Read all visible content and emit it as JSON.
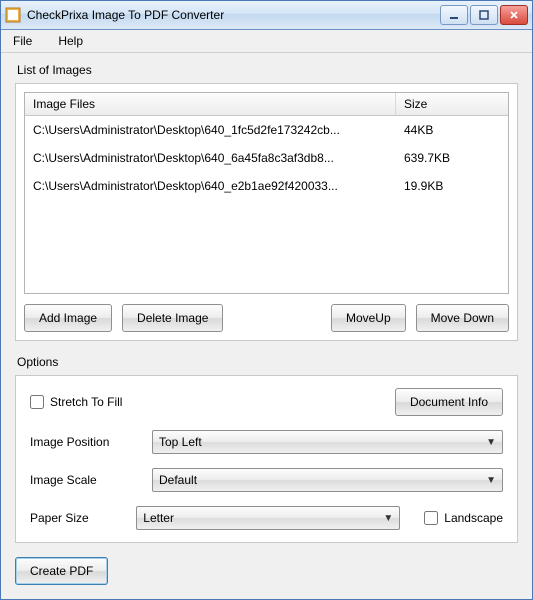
{
  "window": {
    "title": "CheckPrixa Image To PDF Converter"
  },
  "menubar": {
    "file": "File",
    "help": "Help"
  },
  "list": {
    "section_label": "List of Images",
    "header_file": "Image Files",
    "header_size": "Size",
    "rows": [
      {
        "file": "C:\\Users\\Administrator\\Desktop\\640_1fc5d2fe173242cb...",
        "size": "44KB"
      },
      {
        "file": "C:\\Users\\Administrator\\Desktop\\640_6a45fa8c3af3db8...",
        "size": "639.7KB"
      },
      {
        "file": "C:\\Users\\Administrator\\Desktop\\640_e2b1ae92f420033...",
        "size": "19.9KB"
      }
    ]
  },
  "buttons": {
    "add_image": "Add Image",
    "delete_image": "Delete Image",
    "move_up": "MoveUp",
    "move_down": "Move Down",
    "document_info": "Document Info",
    "create_pdf": "Create PDF"
  },
  "options": {
    "section_label": "Options",
    "stretch_label": "Stretch To Fill",
    "image_position_label": "Image Position",
    "image_position_value": "Top Left",
    "image_scale_label": "Image Scale",
    "image_scale_value": "Default",
    "paper_size_label": "Paper Size",
    "paper_size_value": "Letter",
    "landscape_label": "Landscape"
  }
}
